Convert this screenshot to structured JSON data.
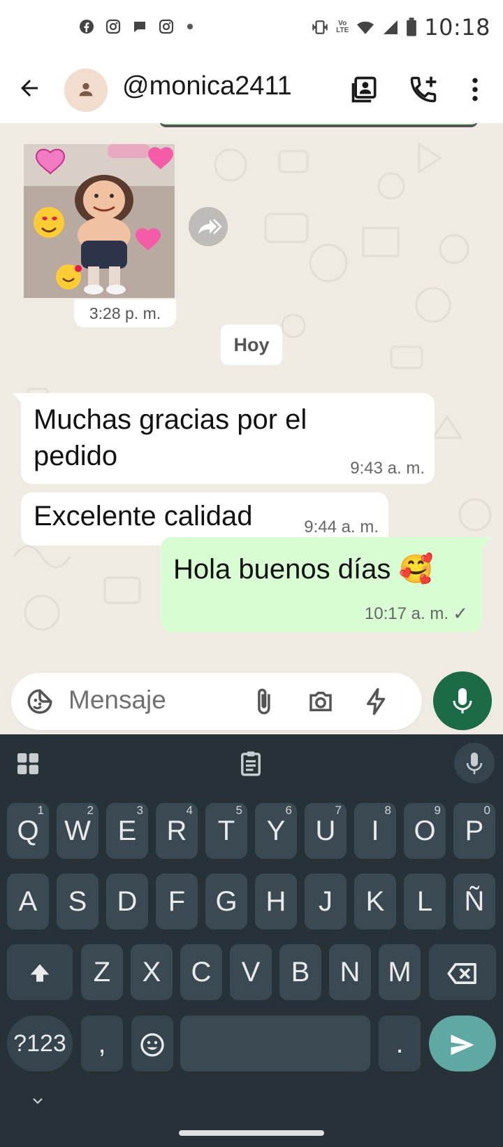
{
  "status_bar": {
    "time": "10:18",
    "volte_top": "Vo",
    "volte_bottom": "LTE",
    "notification_icons": [
      "facebook-icon",
      "instagram-icon",
      "chat-bubble-icon",
      "instagram-icon",
      "dot-icon"
    ],
    "system_icons": [
      "vibrate-icon",
      "volte-icon",
      "wifi-icon",
      "signal-icon",
      "battery-icon"
    ]
  },
  "app_bar": {
    "contact_name": "@monica2411",
    "icons": [
      "back-arrow-icon",
      "avatar",
      "contact-card-icon",
      "add-call-icon",
      "more-vert-icon"
    ]
  },
  "messages": {
    "photo_time": "3:28 p. m.",
    "date_divider": "Hoy",
    "received_1_text": "Muchas gracias por el pedido",
    "received_1_time": "9:43 a. m.",
    "received_2_text": "Excelente calidad",
    "received_2_time": "9:44 a. m.",
    "sent_1_text": "Hola buenos días 🥰",
    "sent_1_time": "10:17 a. m.",
    "sent_1_status": "✓"
  },
  "composer": {
    "placeholder": "Mensaje",
    "icons": [
      "sticker-icon",
      "attach-icon",
      "camera-icon",
      "bolt-icon",
      "mic-icon"
    ]
  },
  "keyboard": {
    "row1": [
      {
        "k": "Q",
        "n": "1"
      },
      {
        "k": "W",
        "n": "2"
      },
      {
        "k": "E",
        "n": "3"
      },
      {
        "k": "R",
        "n": "4"
      },
      {
        "k": "T",
        "n": "5"
      },
      {
        "k": "Y",
        "n": "6"
      },
      {
        "k": "U",
        "n": "7"
      },
      {
        "k": "I",
        "n": "8"
      },
      {
        "k": "O",
        "n": "9"
      },
      {
        "k": "P",
        "n": "0"
      }
    ],
    "row2": [
      "A",
      "S",
      "D",
      "F",
      "G",
      "H",
      "J",
      "K",
      "L",
      "Ñ"
    ],
    "row3": [
      "Z",
      "X",
      "C",
      "V",
      "B",
      "N",
      "M"
    ],
    "symbols_key": "?123",
    "comma_key": ",",
    "period_key": ".",
    "accent_color": "#5fa8a3"
  }
}
